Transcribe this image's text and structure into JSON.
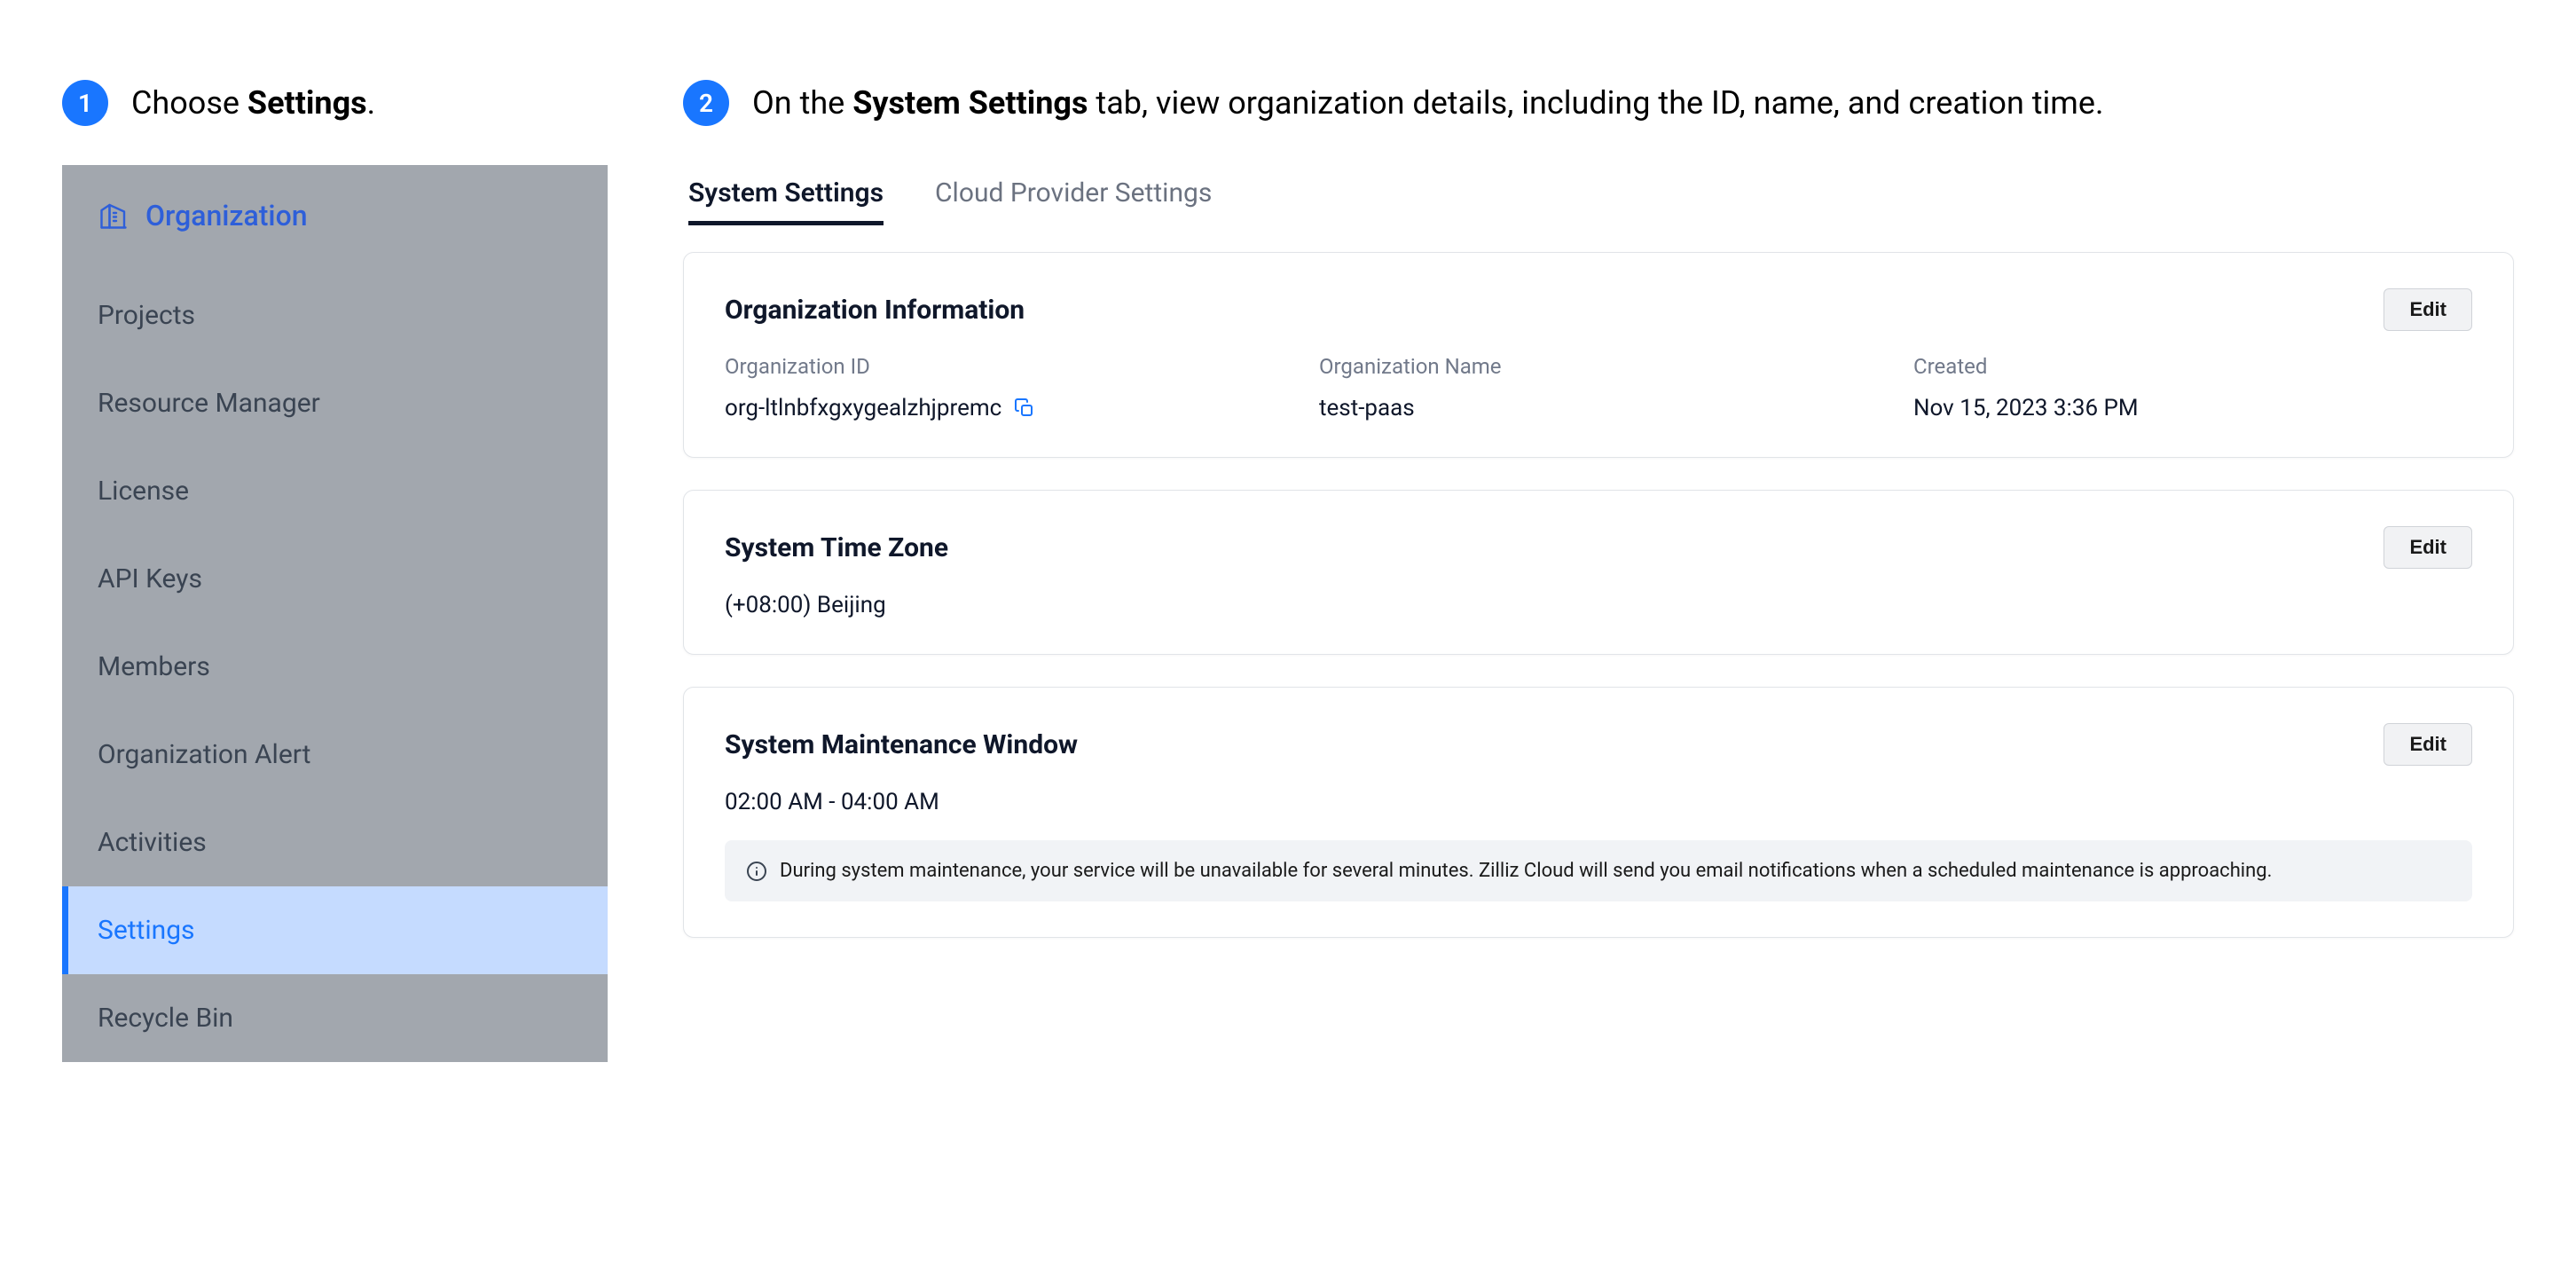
{
  "steps": {
    "one": {
      "number": "1",
      "prefix": "Choose ",
      "bold": "Settings",
      "suffix": "."
    },
    "two": {
      "number": "2",
      "prefix": "On the ",
      "bold": "System Settings",
      "suffix": " tab, view organization details, including the ID, name, and creation time."
    }
  },
  "sidebar": {
    "title": "Organization",
    "items": [
      {
        "label": "Projects"
      },
      {
        "label": "Resource Manager"
      },
      {
        "label": "License"
      },
      {
        "label": "API Keys"
      },
      {
        "label": "Members"
      },
      {
        "label": "Organization Alert"
      },
      {
        "label": "Activities"
      },
      {
        "label": "Settings"
      },
      {
        "label": "Recycle Bin"
      }
    ]
  },
  "tabs": {
    "system": "System Settings",
    "cloud": "Cloud Provider Settings"
  },
  "orgInfo": {
    "title": "Organization Information",
    "edit": "Edit",
    "idLabel": "Organization ID",
    "idValue": "org-ltlnbfxgxygealzhjpremc",
    "nameLabel": "Organization Name",
    "nameValue": "test-paas",
    "createdLabel": "Created",
    "createdValue": "Nov 15, 2023 3:36 PM"
  },
  "timezone": {
    "title": "System Time Zone",
    "edit": "Edit",
    "value": "(+08:00) Beijing"
  },
  "maintenance": {
    "title": "System Maintenance Window",
    "edit": "Edit",
    "value": "02:00 AM - 04:00 AM",
    "notice": "During system maintenance, your service will be unavailable for several minutes. Zilliz Cloud will send you email notifications when a scheduled maintenance is approaching."
  }
}
